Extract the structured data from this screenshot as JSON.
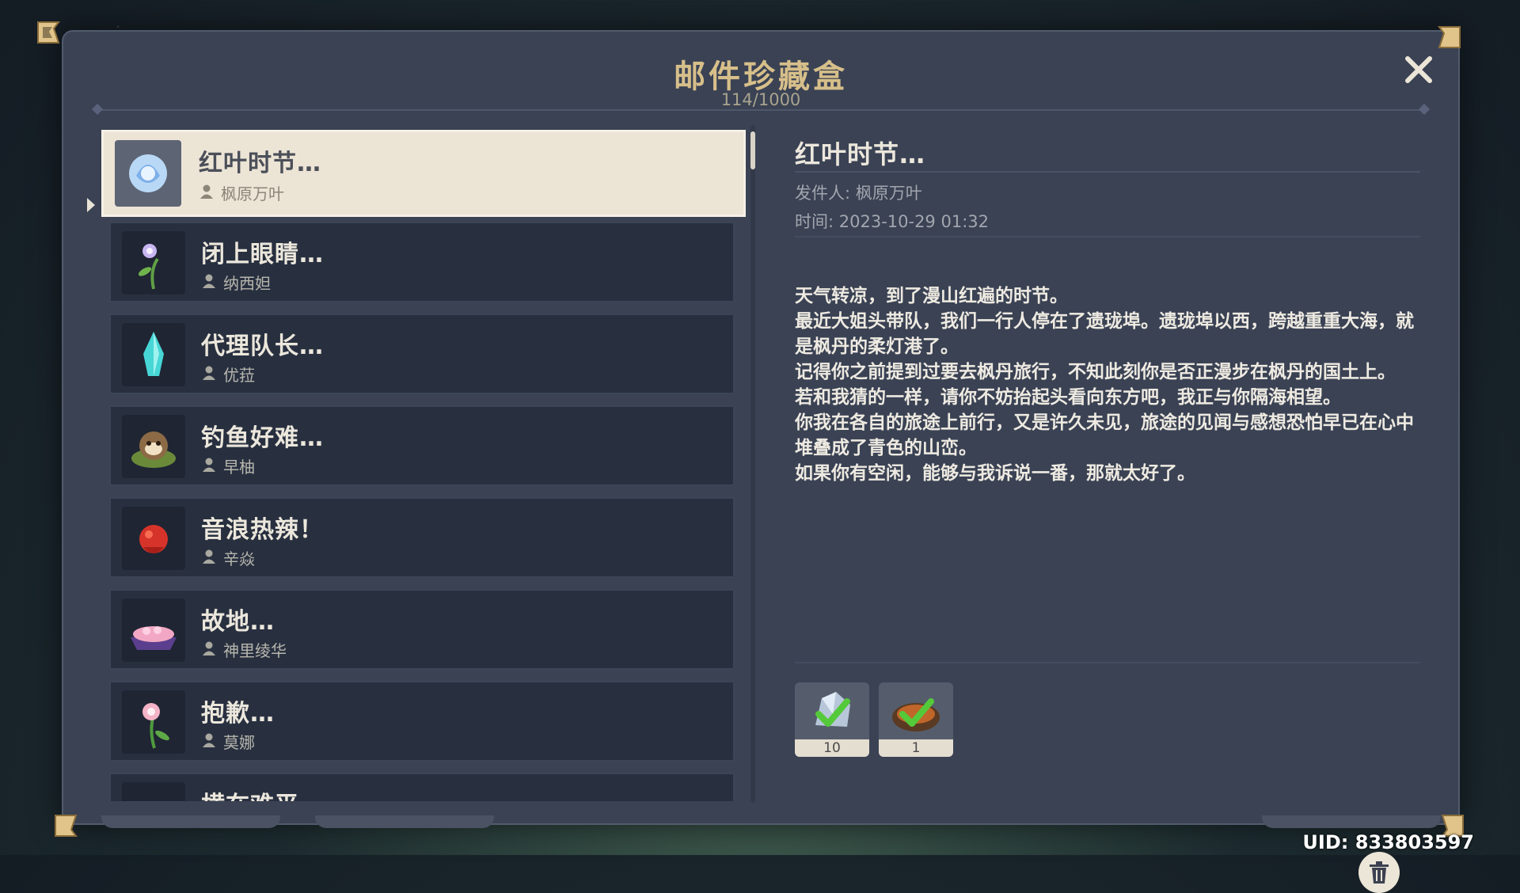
{
  "window": {
    "title": "邮件珍藏盒",
    "count": "114/1000"
  },
  "mails": [
    {
      "subject": "红叶时节…",
      "sender": "枫原万叶",
      "icon": "crystal-rose-icon",
      "selected": true
    },
    {
      "subject": "闭上眼睛…",
      "sender": "纳西妲",
      "icon": "flower-icon",
      "selected": false
    },
    {
      "subject": "代理队长…",
      "sender": "优菈",
      "icon": "ice-crystal-icon",
      "selected": false
    },
    {
      "subject": "钓鱼好难…",
      "sender": "早柚",
      "icon": "tanuki-icon",
      "selected": false
    },
    {
      "subject": "音浪热辣！",
      "sender": "辛焱",
      "icon": "red-flower-icon",
      "selected": false
    },
    {
      "subject": "故地…",
      "sender": "神里绫华",
      "icon": "flower-basket-icon",
      "selected": false
    },
    {
      "subject": "抱歉…",
      "sender": "莫娜",
      "icon": "pink-flower-icon",
      "selected": false
    },
    {
      "subject": "横在难平",
      "sender": "",
      "icon": "partial-item-icon",
      "selected": false
    }
  ],
  "detail": {
    "subject": "红叶时节…",
    "sender_label": "发件人: 枫原万叶",
    "time_label": "时间: 2023-10-29 01:32",
    "body": [
      "天气转凉，到了漫山红遍的时节。",
      "最近大姐头带队，我们一行人停在了遗珑埠。遗珑埠以西，跨越重重大海，就是枫丹的柔灯港了。",
      "记得你之前提到过要去枫丹旅行，不知此刻你是否正漫步在枫丹的国土上。",
      "若和我猜的一样，请你不妨抬起头看向东方吧，我正与你隔海相望。",
      "你我在各自的旅途上前行，又是许久未见，旅途的见闻与感想恐怕早已在心中堆叠成了青色的山峦。",
      "如果你有空闲，能够与我诉说一番，那就太好了。"
    ],
    "attachments": [
      {
        "qty": "10",
        "icon": "crystal-shard-icon",
        "claimed": true
      },
      {
        "qty": "1",
        "icon": "grilled-fish-icon",
        "claimed": true
      }
    ]
  },
  "uid": "UID: 833803597",
  "colors": {
    "title_gold": "#d7bf8a",
    "panel": "#3a4254",
    "item_bg": "#283040",
    "selected_bg": "#ece4d5",
    "check_green": "#54c93a"
  }
}
